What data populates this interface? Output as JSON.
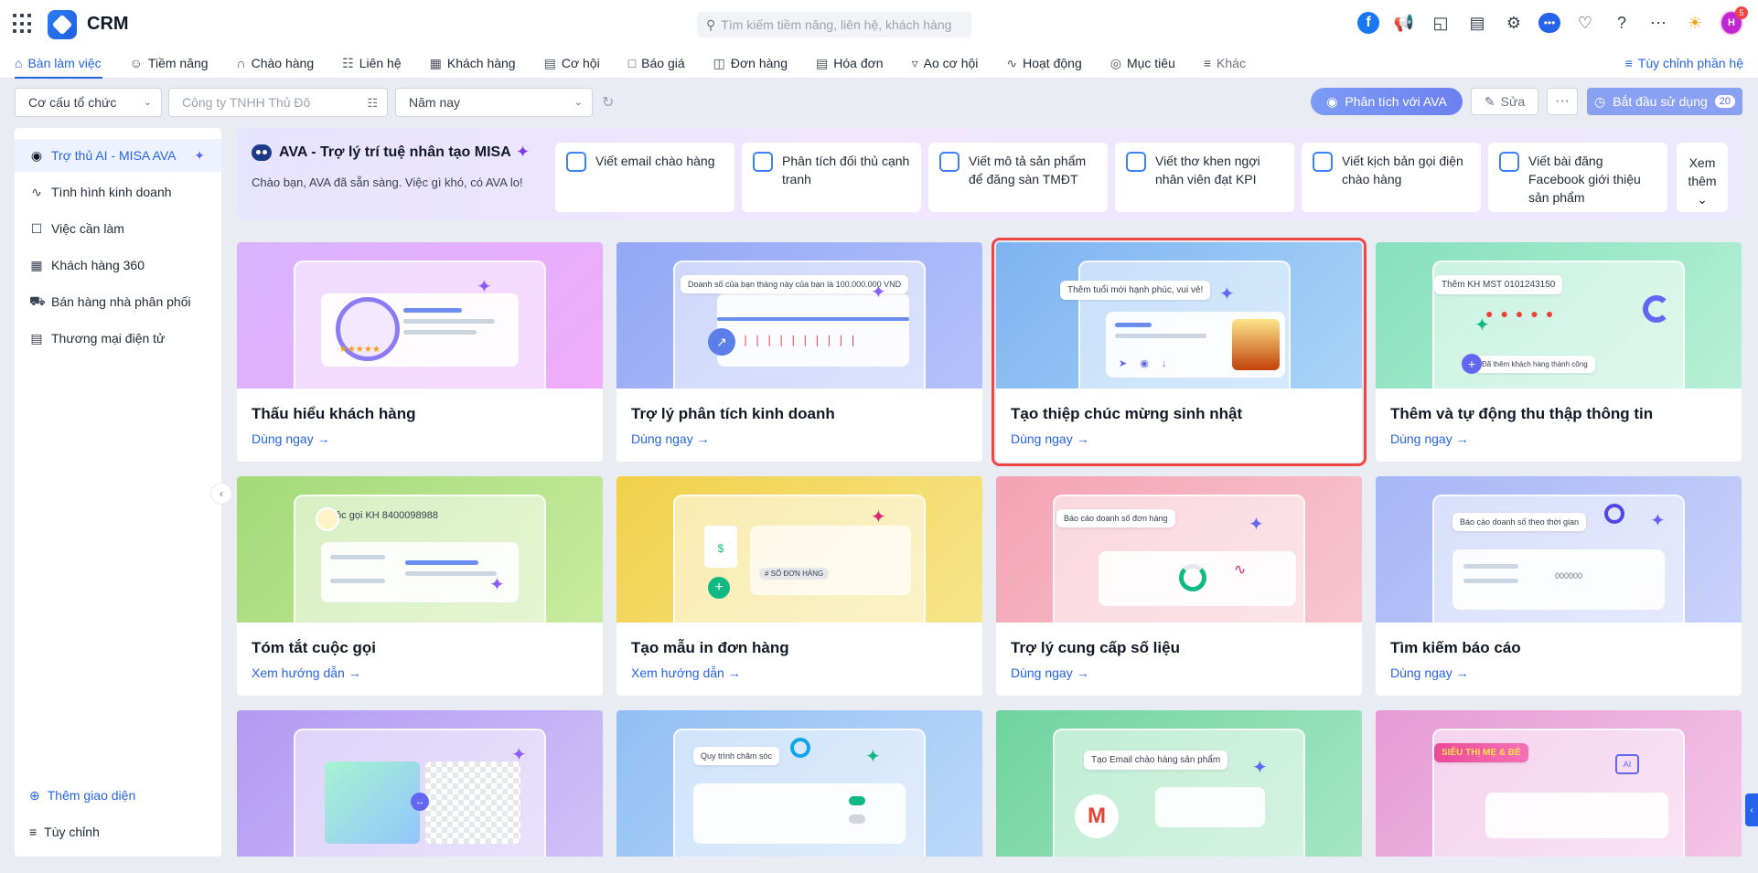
{
  "app": {
    "name": "CRM"
  },
  "search": {
    "placeholder": "Tìm kiếm tiềm năng, liên hệ, khách hàng"
  },
  "user": {
    "initials": "H",
    "notifications": "5"
  },
  "nav": {
    "tabs": [
      {
        "label": "Bàn làm việc",
        "icon": "home-icon"
      },
      {
        "label": "Tiềm năng",
        "icon": "user-icon"
      },
      {
        "label": "Chào hàng",
        "icon": "magnet-icon"
      },
      {
        "label": "Liên hệ",
        "icon": "contact-icon"
      },
      {
        "label": "Khách hàng",
        "icon": "building-icon"
      },
      {
        "label": "Cơ hội",
        "icon": "briefcase-icon"
      },
      {
        "label": "Báo giá",
        "icon": "quote-icon"
      },
      {
        "label": "Đơn hàng",
        "icon": "cart-icon"
      },
      {
        "label": "Hóa đơn",
        "icon": "invoice-icon"
      },
      {
        "label": "Ao cơ hội",
        "icon": "funnel-icon"
      },
      {
        "label": "Hoạt động",
        "icon": "activity-icon"
      },
      {
        "label": "Mục tiêu",
        "icon": "target-icon"
      },
      {
        "label": "Khác",
        "icon": "menu-icon"
      }
    ],
    "customize": "Tùy chỉnh phần hệ"
  },
  "filters": {
    "org": "Cơ cấu tổ chức",
    "company": "Công ty TNHH Thủ Đô",
    "period": "Năm nay"
  },
  "actions": {
    "ava": "Phân tích với AVA",
    "edit": "Sửa",
    "more": "···",
    "start": "Bắt đầu sử dụng",
    "start_count": "20"
  },
  "sidebar": {
    "items": [
      {
        "label": "Trợ thủ AI - MISA AVA"
      },
      {
        "label": "Tình hình kinh doanh"
      },
      {
        "label": "Việc cần làm"
      },
      {
        "label": "Khách hàng 360"
      },
      {
        "label": "Bán hàng nhà phân phối"
      },
      {
        "label": "Thương mại điện tử"
      }
    ],
    "add": "Thêm giao diện",
    "customize": "Tùy chỉnh"
  },
  "ava": {
    "title": "AVA - Trợ lý trí tuệ nhân tạo MISA",
    "subtitle": "Chào bạn, AVA đã sẵn sàng. Việc gì khó, có AVA lo!",
    "prompts": [
      "Viết email chào hàng",
      "Phân tích đối thủ cạnh tranh",
      "Viết mô tả sản phẩm để đăng sàn TMĐT",
      "Viết thơ khen ngợi nhân viên đạt KPI",
      "Viết kịch bản gọi điện chào hàng",
      "Viết bài đăng Facebook giới thiệu sản phẩm"
    ],
    "more": "Xem thêm"
  },
  "cards": [
    {
      "title": "Thấu hiểu khách hàng",
      "link": "Dùng ngay"
    },
    {
      "title": "Trợ lý phân tích kinh doanh",
      "link": "Dùng ngay",
      "chip": "Doanh số của bạn tháng này của bạn là 100.000.000 VND"
    },
    {
      "title": "Tạo thiệp chúc mừng sinh nhật",
      "link": "Dùng ngay",
      "chip": "Thêm tuổi mới hạnh phúc, vui vẻ!"
    },
    {
      "title": "Thêm và tự động thu thập thông tin",
      "link": "Dùng ngay",
      "chip": "Thêm KH MST 0101243150",
      "chip2": "Đã thêm khách hàng thành công"
    },
    {
      "title": "Tóm tắt cuộc gọi",
      "link": "Xem hướng dẫn",
      "chip": "Cuộc gọi KH 8400098988"
    },
    {
      "title": "Tạo mẫu in đơn hàng",
      "link": "Xem hướng dẫn",
      "chip": "# SỐ ĐƠN HÀNG"
    },
    {
      "title": "Trợ lý cung cấp số liệu",
      "link": "Dùng ngay",
      "chip": "Báo cáo doanh số đơn hàng"
    },
    {
      "title": "Tìm kiếm báo cáo",
      "link": "Dùng ngay",
      "chip": "Báo cáo doanh số theo thời gian",
      "chip2": "000000"
    },
    {
      "title": "",
      "link": ""
    },
    {
      "title": "",
      "link": "",
      "chip": "Quy trình chăm sóc"
    },
    {
      "title": "",
      "link": "",
      "chip": "Tạo Email chào hàng sản phẩm"
    },
    {
      "title": "",
      "link": "",
      "chip": "SIÊU THỊ MẸ & BÉ"
    }
  ]
}
